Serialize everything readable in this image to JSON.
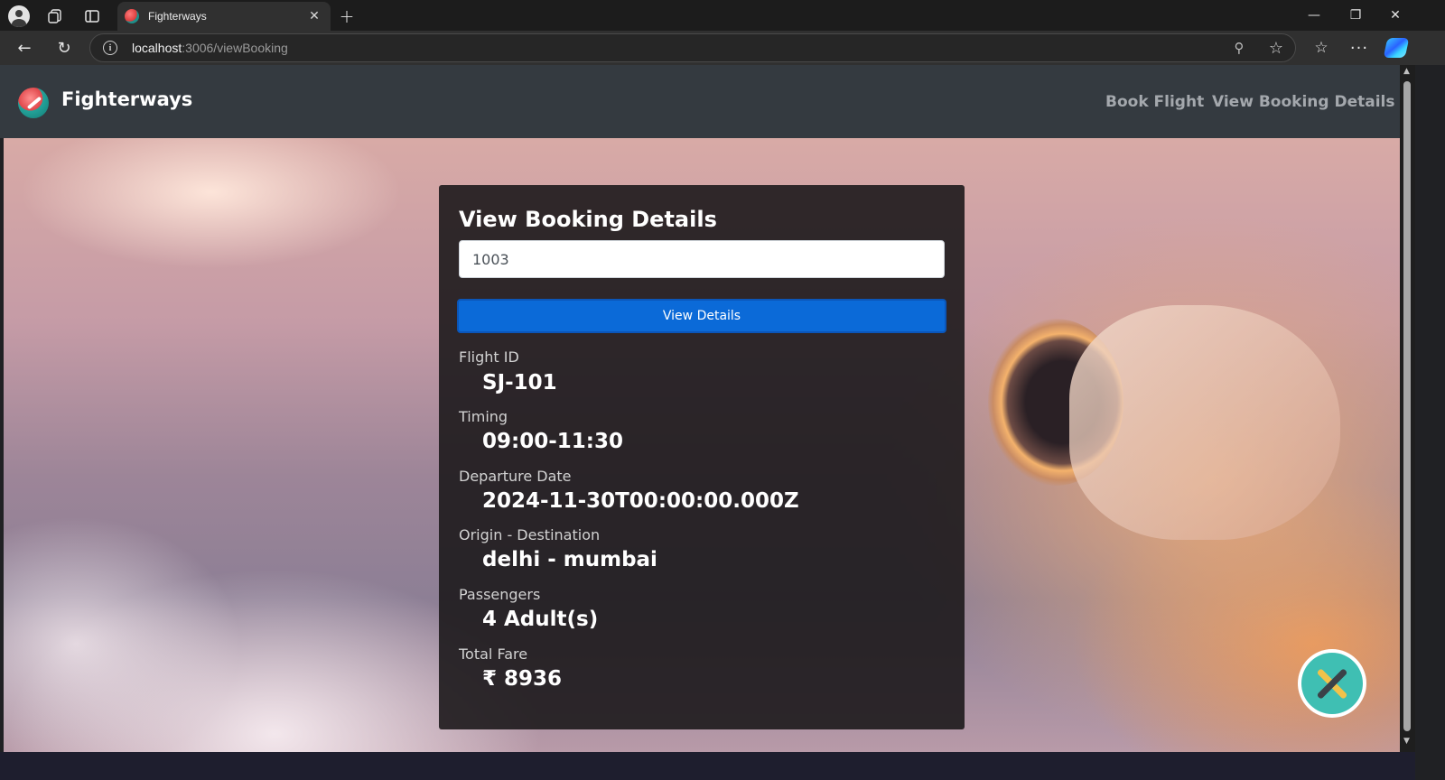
{
  "browser": {
    "tab": {
      "title": "Fighterways",
      "close_glyph": "✕"
    },
    "new_tab_glyph": "+",
    "window_controls": {
      "minimize": "—",
      "restore": "❐",
      "close": "✕"
    },
    "address": {
      "host": "localhost",
      "path": ":3006/viewBooking"
    },
    "icons": {
      "profile": "profile-icon",
      "workspaces": "workspaces-icon",
      "tab_actions": "tab-actions-icon",
      "back": "←",
      "reload": "↻",
      "info": "i",
      "zoom": "⚲",
      "star": "☆",
      "favorites": "☆",
      "more": "···",
      "copilot": "copilot-icon"
    }
  },
  "navbar": {
    "brand": "Fighterways",
    "links": [
      "Book Flight",
      "View Booking Details"
    ]
  },
  "booking": {
    "title": "View Booking Details",
    "input_value": "1003",
    "button_label": "View Details",
    "details": [
      {
        "label": "Flight ID",
        "value": "SJ-101"
      },
      {
        "label": "Timing",
        "value": "09:00-11:30"
      },
      {
        "label": "Departure Date",
        "value": "2024-11-30T00:00:00.000Z"
      },
      {
        "label": "Origin - Destination",
        "value": "delhi - mumbai"
      },
      {
        "label": "Passengers",
        "value": "4 Adult(s)"
      },
      {
        "label": "Total Fare",
        "value": "₹ 8936"
      }
    ]
  },
  "colors": {
    "navbar_bg": "#343a40",
    "card_bg": "#1d191c",
    "button_primary": "#0b6ad8",
    "nav_link": "#a4a8ad"
  },
  "fab": {
    "icon": "tools-icon"
  }
}
